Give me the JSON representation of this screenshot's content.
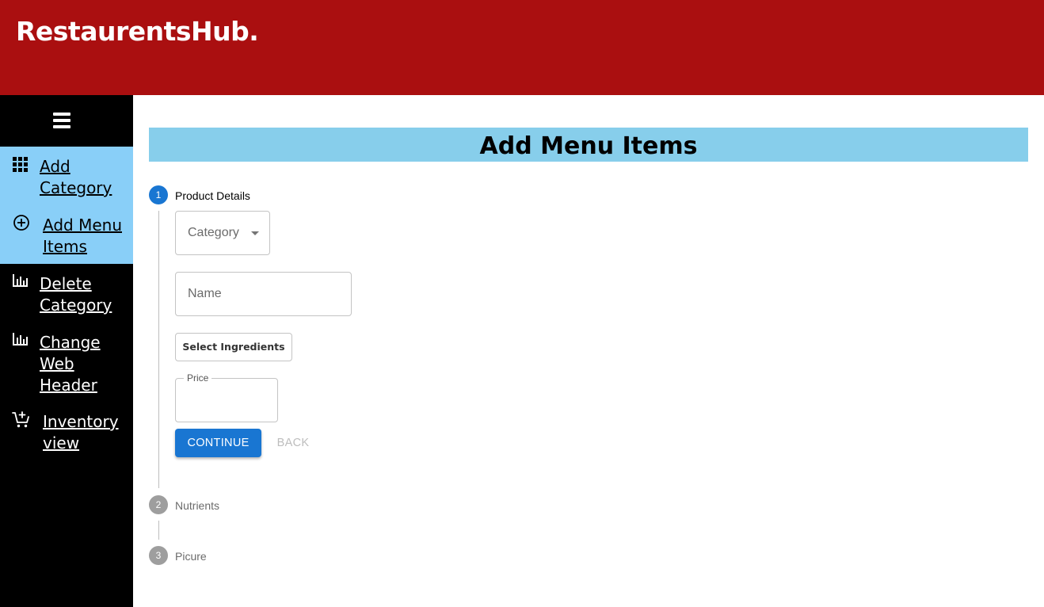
{
  "app": {
    "brand": "RestaurentsHub."
  },
  "sidebar": {
    "menu_icon": "hamburger-menu-icon",
    "items": [
      {
        "label_line1": "Add",
        "label_line2": "Category",
        "icon": "grid-icon",
        "highlighted": true
      },
      {
        "label_line1": "Add Menu",
        "label_line2": "Items",
        "icon": "add-circle-icon",
        "highlighted": true,
        "active": true
      },
      {
        "label_line1": "Delete",
        "label_line2": "Category",
        "icon": "bar-chart-icon",
        "highlighted": false
      },
      {
        "label_line1": "Change",
        "label_line2": "Web",
        "label_line3": "Header",
        "icon": "bar-chart-icon",
        "highlighted": false
      },
      {
        "label_line1": "Inventory",
        "label_line2": "view",
        "icon": "add-shopping-cart-icon",
        "highlighted": false
      }
    ]
  },
  "main": {
    "title": "Add Menu Items",
    "steps": [
      {
        "number": "1",
        "label": "Product Details",
        "state": "active"
      },
      {
        "number": "2",
        "label": "Nutrients",
        "state": "inactive"
      },
      {
        "number": "3",
        "label": "Picure",
        "state": "inactive"
      }
    ],
    "form": {
      "category_select": {
        "value": "Category"
      },
      "name_field": {
        "placeholder": "Name"
      },
      "ingredients_button": "Select Ingredients",
      "price_field": {
        "label": "Price",
        "value": ""
      },
      "continue_button": "CONTINUE",
      "back_button": "BACK"
    }
  },
  "colors": {
    "header_bg": "#aa0f10",
    "sidebar_bg": "#000000",
    "sidebar_highlight": "#89cff8",
    "title_bar_bg": "#87ceeb",
    "primary": "#1976d2",
    "step_inactive": "#9e9e9e"
  }
}
